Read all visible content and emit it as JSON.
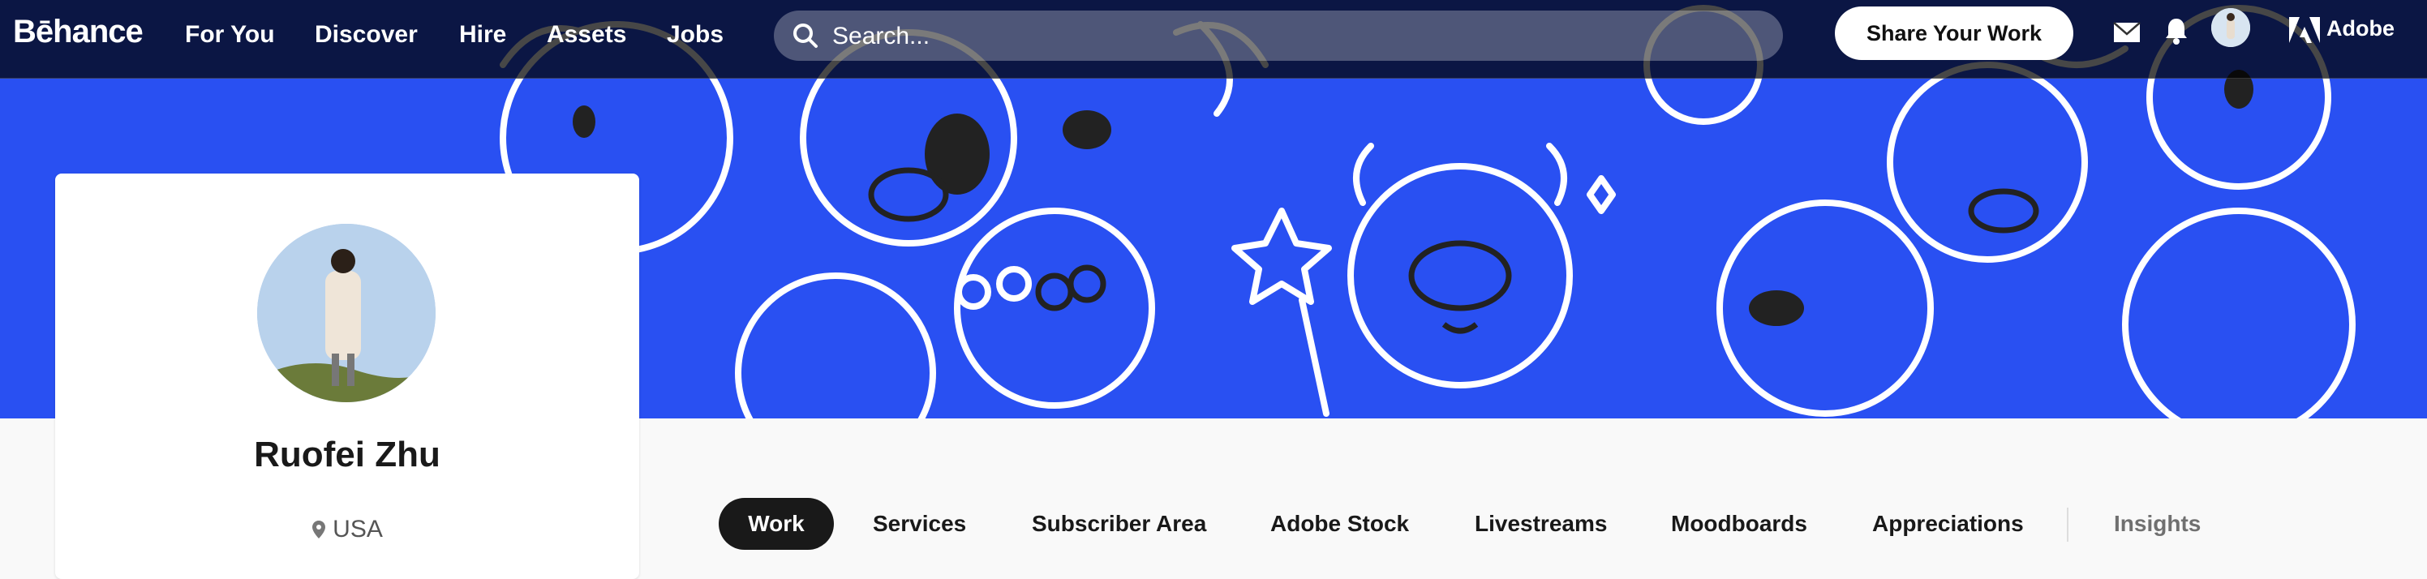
{
  "app": {
    "logo": "Bēhance"
  },
  "nav": {
    "items": [
      "For You",
      "Discover",
      "Hire",
      "Assets",
      "Jobs"
    ]
  },
  "search": {
    "placeholder": "Search..."
  },
  "header": {
    "share_label": "Share Your Work",
    "adobe_label": "Adobe"
  },
  "profile": {
    "name": "Ruofei Zhu",
    "location": "USA"
  },
  "tabs": [
    "Work",
    "Services",
    "Subscriber Area",
    "Adobe Stock",
    "Livestreams",
    "Moodboards",
    "Appreciations",
    "Insights"
  ],
  "colors": {
    "banner": "#2950f2",
    "topbar": "#1a1a1a",
    "active_tab": "#191919"
  },
  "icons": [
    "search-icon",
    "mail-icon",
    "bell-icon",
    "adobe-logo-icon",
    "location-pin-icon"
  ]
}
